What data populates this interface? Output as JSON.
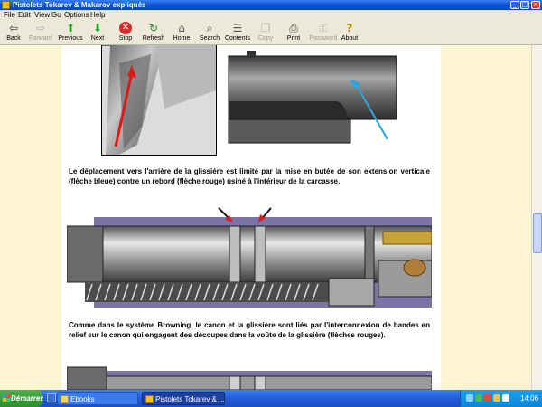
{
  "window": {
    "title": "Pistolets Tokarev & Makarov expliqués"
  },
  "menu": [
    "File",
    "Edit",
    "View",
    "Go",
    "Options",
    "Help"
  ],
  "toolbar": {
    "back": "Back",
    "forward": "Forward",
    "previous": "Previous",
    "next": "Next",
    "stop": "Stop",
    "refresh": "Refresh",
    "home": "Home",
    "search": "Search",
    "contents": "Contents",
    "copy": "Copy",
    "print": "Print",
    "password": "Password",
    "about": "About"
  },
  "content": {
    "paragraph1": "Le déplacement vers l'arrière de la glissière est limité par la mise en butée de son extension verticale (flèche bleue) contre un rebord (flèche rouge) usiné à l'intérieur de la carcasse.",
    "paragraph2": "Comme dans le système Browning, le canon et la glissière sont liés par l'interconnexion de bandes en relief sur le canon qui engagent des découpes dans la voûte de la glissière (flèches rouges)."
  },
  "taskbar": {
    "start": "Démarrer",
    "tasks": [
      "Ebooks",
      "Pistolets Tokarev & ..."
    ],
    "clock": "14:06"
  },
  "colors": {
    "titlebar": "#0a4fd6",
    "page_margin": "#fdf4d2",
    "diagram_bg": "#7b74a6",
    "arrow_red": "#e01818",
    "arrow_blue": "#2aa6e0"
  }
}
